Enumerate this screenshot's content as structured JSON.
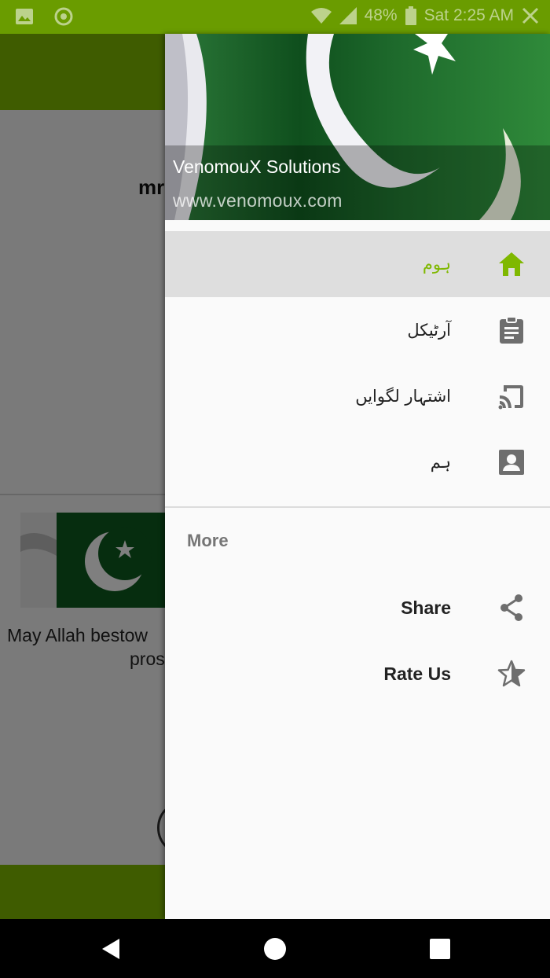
{
  "status_bar": {
    "battery": "48%",
    "time": "Sat 2:25 AM"
  },
  "background_app": {
    "title_peek": "mr",
    "caption_line1": "May Allah bestow",
    "caption_line2": "pros"
  },
  "drawer": {
    "header": {
      "title": "VenomouX Solutions",
      "subtitle": "www.venomoux.com"
    },
    "items": [
      {
        "label": "ہوم",
        "icon": "home-icon",
        "selected": true
      },
      {
        "label": "آرٹیکل",
        "icon": "clipboard-icon",
        "selected": false
      },
      {
        "label": "اشتہار لگوایں",
        "icon": "cast-icon",
        "selected": false
      },
      {
        "label": "ہم",
        "icon": "contact-card-icon",
        "selected": false
      }
    ],
    "section_header": "More",
    "more_items": [
      {
        "label": "Share",
        "icon": "share-icon"
      },
      {
        "label": "Rate Us",
        "icon": "star-half-icon"
      }
    ]
  },
  "colors": {
    "accent": "#7fb800",
    "status_bar": "#6a9c00",
    "icon_gray": "#6e6e6e"
  }
}
